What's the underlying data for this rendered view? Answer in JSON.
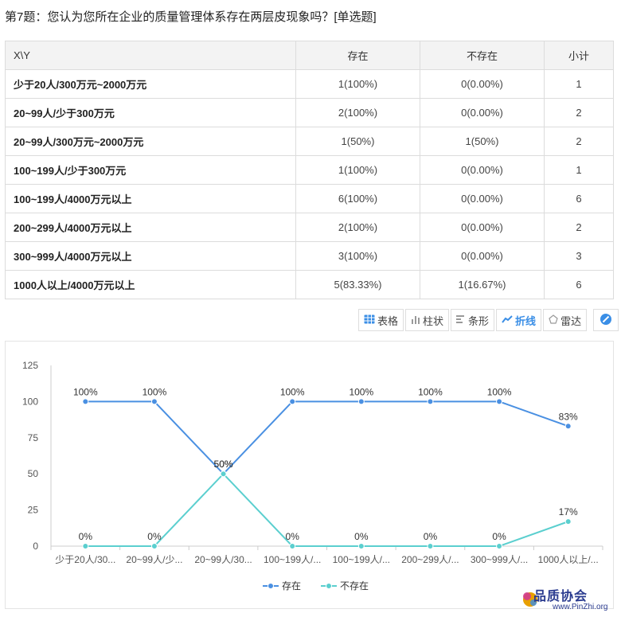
{
  "question": "第7题：您认为您所在企业的质量管理体系存在两层皮现象吗？[单选题]",
  "table": {
    "headers": [
      "X\\Y",
      "存在",
      "不存在",
      "小计"
    ],
    "rows": [
      {
        "label": "少于20人/300万元~2000万元",
        "exist": "1(100%)",
        "not_exist": "0(0.00%)",
        "subtotal": "1"
      },
      {
        "label": "20~99人/少于300万元",
        "exist": "2(100%)",
        "not_exist": "0(0.00%)",
        "subtotal": "2"
      },
      {
        "label": "20~99人/300万元~2000万元",
        "exist": "1(50%)",
        "not_exist": "1(50%)",
        "subtotal": "2"
      },
      {
        "label": "100~199人/少于300万元",
        "exist": "1(100%)",
        "not_exist": "0(0.00%)",
        "subtotal": "1"
      },
      {
        "label": "100~199人/4000万元以上",
        "exist": "6(100%)",
        "not_exist": "0(0.00%)",
        "subtotal": "6"
      },
      {
        "label": "200~299人/4000万元以上",
        "exist": "2(100%)",
        "not_exist": "0(0.00%)",
        "subtotal": "2"
      },
      {
        "label": "300~999人/4000万元以上",
        "exist": "3(100%)",
        "not_exist": "0(0.00%)",
        "subtotal": "3"
      },
      {
        "label": "1000人以上/4000万元以上",
        "exist": "5(83.33%)",
        "not_exist": "1(16.67%)",
        "subtotal": "6"
      }
    ]
  },
  "toolbar": {
    "table": "表格",
    "column": "柱状",
    "bar": "条形",
    "line": "折线",
    "radar": "雷达",
    "table_icon": "table-icon",
    "column_icon": "column-chart-icon",
    "bar_icon": "bar-chart-icon",
    "line_icon": "line-chart-icon",
    "radar_icon": "radar-icon",
    "extra_icon": "circle-slash-icon",
    "active": "line"
  },
  "chart_data": {
    "type": "line",
    "categories": [
      "少于20人/30...",
      "20~99人/少...",
      "20~99人/30...",
      "100~199人/...",
      "100~199人/...",
      "200~299人/...",
      "300~999人/...",
      "1000人以上/..."
    ],
    "series": [
      {
        "name": "存在",
        "values": [
          100,
          100,
          50,
          100,
          100,
          100,
          100,
          83
        ],
        "labels": [
          "100%",
          "100%",
          "50%",
          "100%",
          "100%",
          "100%",
          "100%",
          "83%"
        ],
        "color": "#4a90e2"
      },
      {
        "name": "不存在",
        "values": [
          0,
          0,
          50,
          0,
          0,
          0,
          0,
          17
        ],
        "labels": [
          "0%",
          "0%",
          "50%",
          "0%",
          "0%",
          "0%",
          "0%",
          "17%"
        ],
        "color": "#5bcfcf"
      }
    ],
    "ylim": [
      0,
      125
    ],
    "yticks": [
      0,
      25,
      50,
      75,
      100,
      125
    ],
    "legend_position": "bottom-center",
    "grid": false
  },
  "watermark": {
    "text": "品质协会",
    "url": "www.PinZhi.org"
  }
}
